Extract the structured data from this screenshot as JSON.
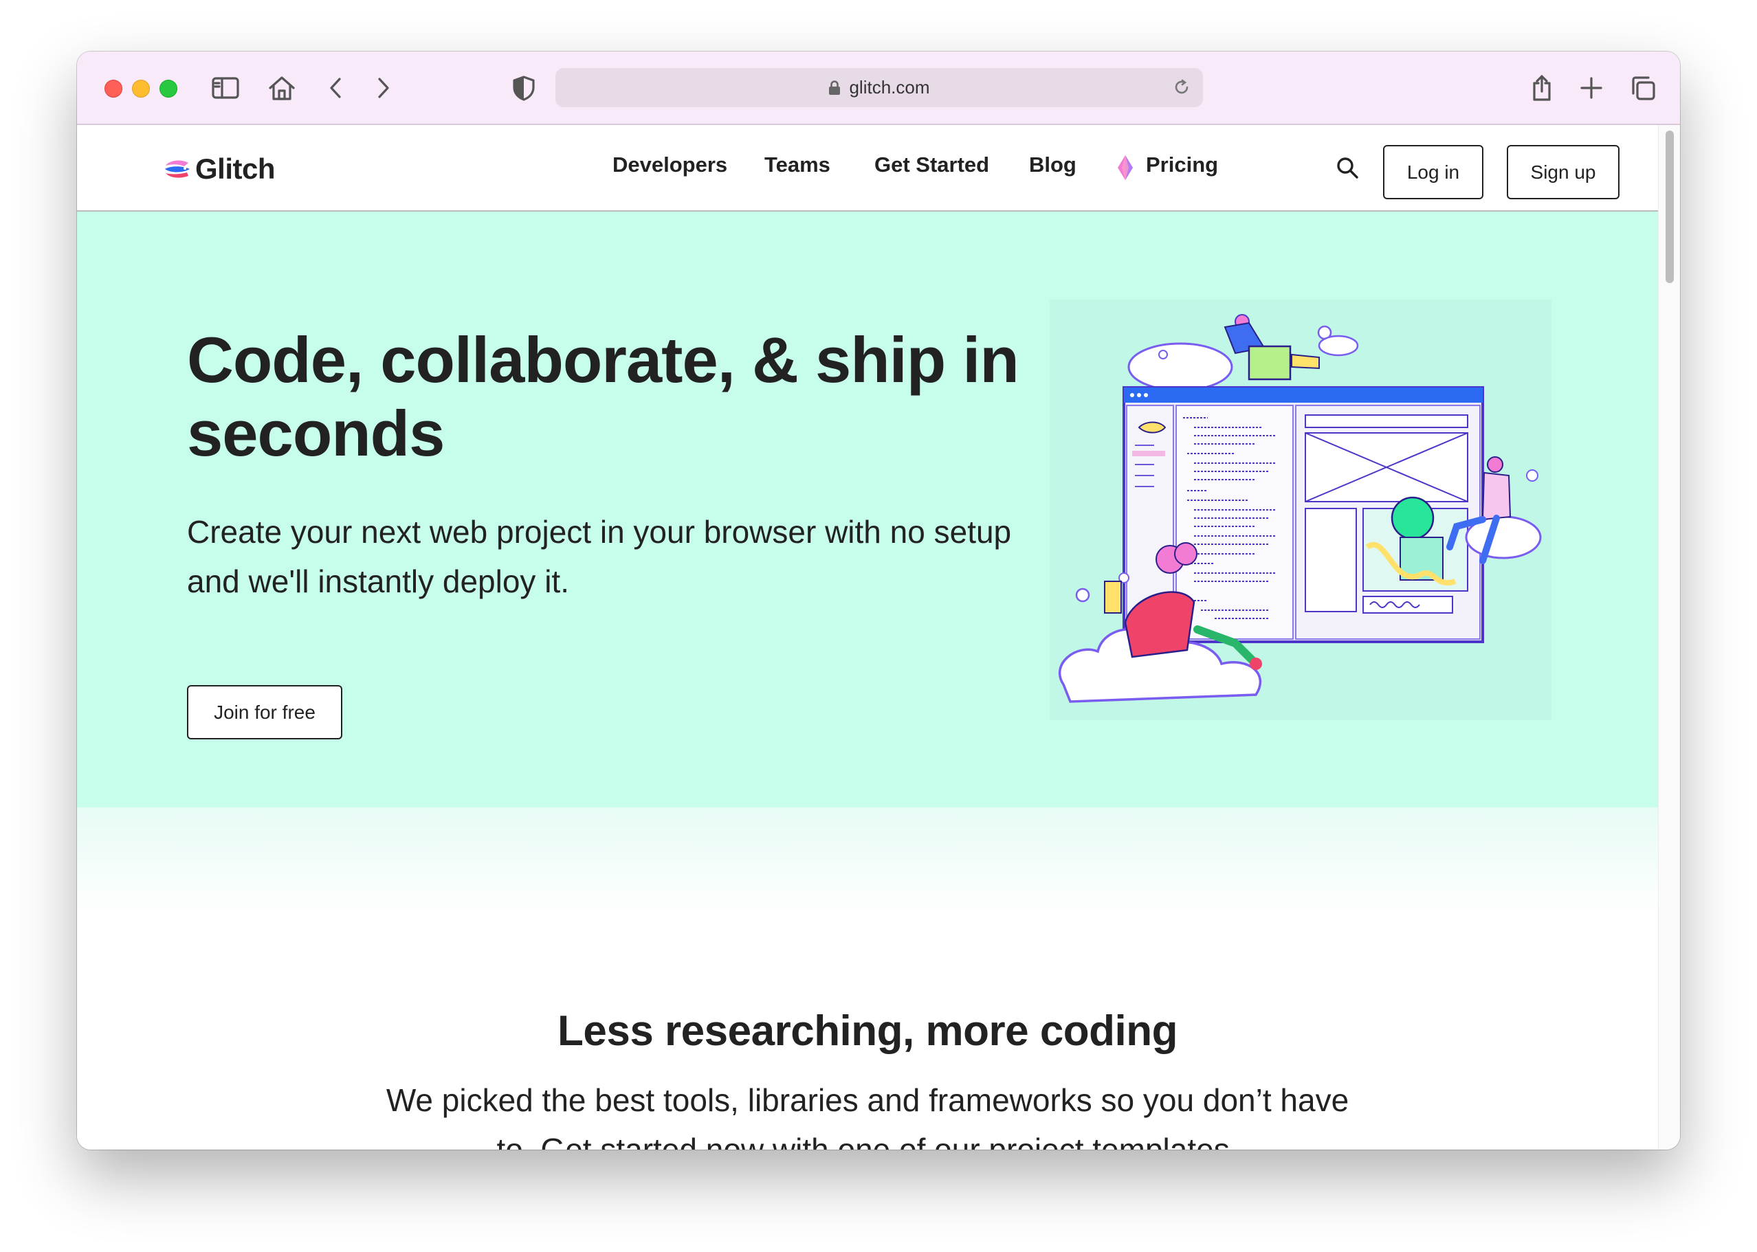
{
  "browser": {
    "url": "glitch.com",
    "icons": [
      "sidebar-icon",
      "home-icon",
      "back-icon",
      "forward-icon",
      "shield-icon",
      "lock-icon",
      "reload-icon",
      "share-icon",
      "new-tab-icon",
      "tabs-overview-icon"
    ]
  },
  "nav": {
    "logo_text": "Glitch",
    "links": [
      "Developers",
      "Teams",
      "Get Started",
      "Blog",
      "Pricing"
    ],
    "login_label": "Log in",
    "signup_label": "Sign up"
  },
  "hero": {
    "title": "Code, collaborate, & ship in seconds",
    "subtitle": "Create your next web project in your browser with no setup and we'll instantly deploy it.",
    "cta_label": "Join for free"
  },
  "section": {
    "title": "Less researching, more coding",
    "subtitle": "We picked the best tools, libraries and frameworks so you don’t have to. Get started now with one of our project templates."
  },
  "colors": {
    "hero_bg": "#c6fdeb",
    "chrome_bg": "#f8eaf8",
    "text": "#222222",
    "accent_blue": "#2b6bf3",
    "accent_pink": "#f27bd3"
  }
}
